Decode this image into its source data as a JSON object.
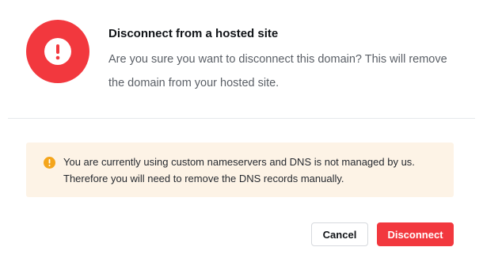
{
  "dialog": {
    "title": "Disconnect from a hosted site",
    "message": "Are you sure you want to disconnect this domain? This will remove the domain from your hosted site.",
    "icon": "alert-exclamation-icon",
    "icon_color": "#f2383e"
  },
  "notice": {
    "text": "You are currently using custom nameservers and DNS is not managed by us. Therefore you will need to remove the DNS records manually.",
    "icon": "warning-icon",
    "icon_color": "#f4a51c",
    "background": "#fdf3e6"
  },
  "actions": {
    "cancel_label": "Cancel",
    "disconnect_label": "Disconnect",
    "danger_color": "#f2383e"
  }
}
